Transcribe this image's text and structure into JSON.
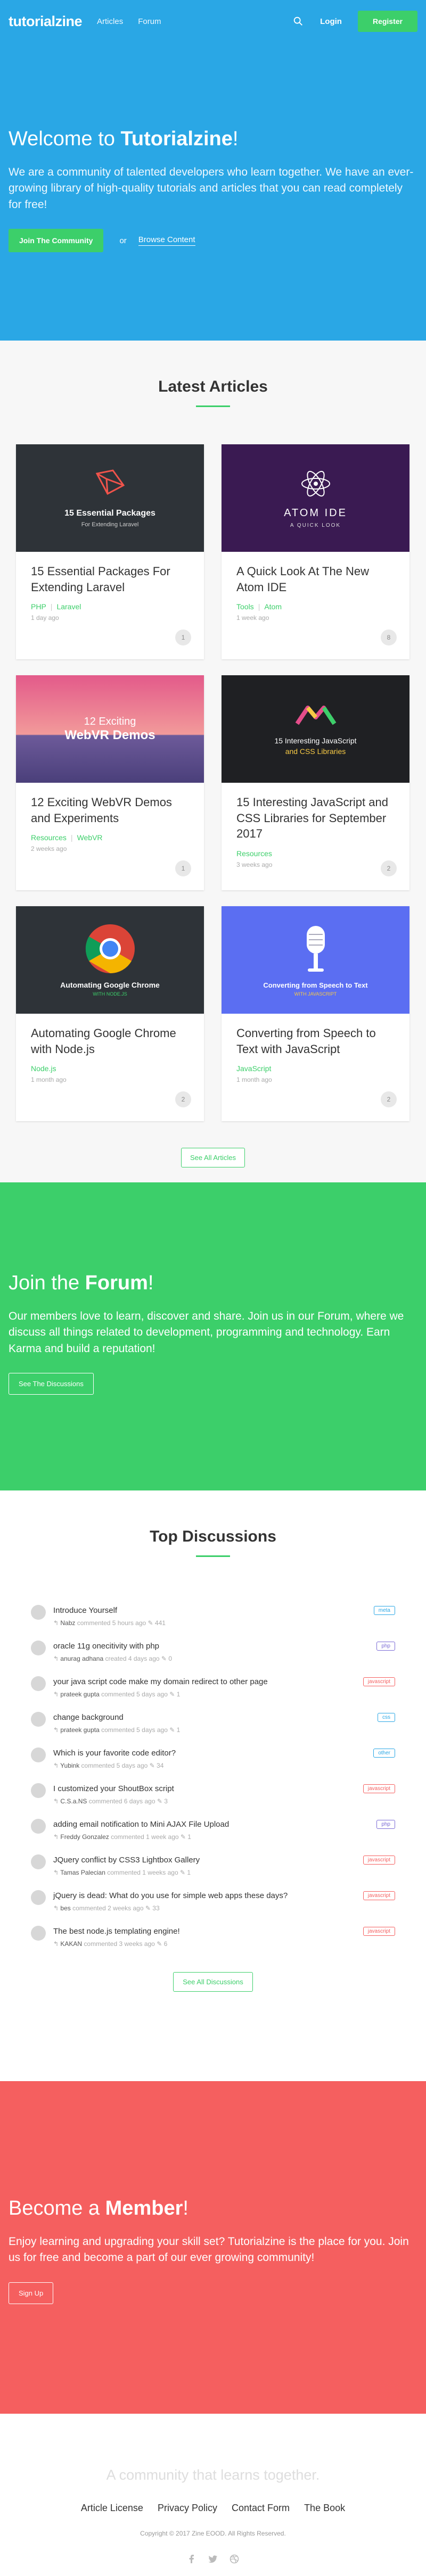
{
  "nav": {
    "brand": "tutorialzine",
    "links": [
      "Articles",
      "Forum"
    ],
    "login": "Login",
    "register": "Register"
  },
  "hero": {
    "title_prefix": "Welcome to ",
    "title_brand": "Tutorialzine",
    "title_suffix": "!",
    "text": "We are a community of talented developers who learn together. We have an ever-growing library of high-quality tutorials and articles that you can read completely for free!",
    "join": "Join The Community",
    "or": "or",
    "browse": "Browse Content"
  },
  "articles": {
    "title": "Latest Articles",
    "see_all": "See All Articles",
    "items": [
      {
        "thumb": {
          "line1": "15 Essential Packages",
          "line2": "For Extending Laravel"
        },
        "title": "15 Essential Packages For Extending Laravel",
        "tags": [
          "PHP",
          "Laravel"
        ],
        "date": "1 day ago",
        "count": "1"
      },
      {
        "thumb": {
          "line1": "ATOM IDE",
          "line2": "A QUICK LOOK"
        },
        "title": "A Quick Look At The New Atom IDE",
        "tags": [
          "Tools",
          "Atom"
        ],
        "date": "1 week ago",
        "count": "8"
      },
      {
        "thumb": {
          "line1": "12 Exciting",
          "line2": "WebVR Demos"
        },
        "title": "12 Exciting WebVR Demos and Experiments",
        "tags": [
          "Resources",
          "WebVR"
        ],
        "date": "2 weeks ago",
        "count": "1"
      },
      {
        "thumb": {
          "line1": "15 Interesting JavaScript",
          "line2": "and CSS Libraries"
        },
        "title": "15 Interesting JavaScript and CSS Libraries for September 2017",
        "tags": [
          "Resources"
        ],
        "date": "3 weeks ago",
        "count": "2"
      },
      {
        "thumb": {
          "line1": "Automating Google Chrome",
          "line2": "WITH NODE.JS"
        },
        "title": "Automating Google Chrome with Node.js",
        "tags": [
          "Node.js"
        ],
        "date": "1 month ago",
        "count": "2"
      },
      {
        "thumb": {
          "line1": "Converting from Speech to Text",
          "line2": "WITH JAVASCRIPT"
        },
        "title": "Converting from Speech to Text with JavaScript",
        "tags": [
          "JavaScript"
        ],
        "date": "1 month ago",
        "count": "2"
      }
    ]
  },
  "forum": {
    "title_prefix": "Join the ",
    "title_brand": "Forum",
    "title_suffix": "!",
    "text": "Our members love to learn, discover and share. Join us in our Forum, where we discuss all things related to development, programming and technology. Earn Karma and build a reputation!",
    "cta": "See The Discussions"
  },
  "discussions": {
    "title": "Top Discussions",
    "see_all": "See All Discussions",
    "items": [
      {
        "title": "Introduce Yourself",
        "user": "Nabz",
        "action": "commented",
        "time": "5 hours ago",
        "count": "441",
        "badge": "meta",
        "color": "#2aa7e5"
      },
      {
        "title": "oracle 11g onecitivity with php",
        "user": "anurag adhana",
        "action": "created",
        "time": "4 days ago",
        "count": "0",
        "badge": "php",
        "color": "#7b6bd6"
      },
      {
        "title": "your java script code make my domain redirect to other page",
        "user": "prateek gupta",
        "action": "commented",
        "time": "5 days ago",
        "count": "1",
        "badge": "javascript",
        "color": "#f55f5f"
      },
      {
        "title": "change background",
        "user": "prateek gupta",
        "action": "commented",
        "time": "5 days ago",
        "count": "1",
        "badge": "css",
        "color": "#2aa7e5"
      },
      {
        "title": "Which is your favorite code editor?",
        "user": "Yubink",
        "action": "commented",
        "time": "5 days ago",
        "count": "34",
        "badge": "other",
        "color": "#2aa7e5"
      },
      {
        "title": "I customized your ShoutBox script",
        "user": "C.S.a.NS",
        "action": "commented",
        "time": "6 days ago",
        "count": "3",
        "badge": "javascript",
        "color": "#f55f5f"
      },
      {
        "title": "adding email notification to Mini AJAX File Upload",
        "user": "Freddy Gonzalez",
        "action": "commented",
        "time": "1 week ago",
        "count": "1",
        "badge": "php",
        "color": "#7b6bd6"
      },
      {
        "title": "JQuery conflict by CSS3 Lightbox Gallery",
        "user": "Tamas Palecian",
        "action": "commented",
        "time": "1 weeks ago",
        "count": "1",
        "badge": "javascript",
        "color": "#f55f5f"
      },
      {
        "title": "jQuery is dead: What do you use for simple web apps these days?",
        "user": "bes",
        "action": "commented",
        "time": "2 weeks ago",
        "count": "33",
        "badge": "javascript",
        "color": "#f55f5f"
      },
      {
        "title": "The best node.js templating engine!",
        "user": "KAKAN",
        "action": "commented",
        "time": "3 weeks ago",
        "count": "6",
        "badge": "javascript",
        "color": "#f55f5f"
      }
    ]
  },
  "member": {
    "title_prefix": "Become a ",
    "title_brand": "Member",
    "title_suffix": "!",
    "text": "Enjoy learning and upgrading your skill set? Tutorialzine is the place for you. Join us for free and become a part of our ever growing community!",
    "cta": "Sign Up"
  },
  "footer": {
    "tagline": "A community that learns together.",
    "links": [
      "Article License",
      "Privacy Policy",
      "Contact Form",
      "The Book"
    ],
    "copyright": "Copyright © 2017 Zine EOOD. All Rights Reserved.",
    "social": [
      "facebook-icon",
      "twitter-icon",
      "dribbble-icon"
    ]
  }
}
